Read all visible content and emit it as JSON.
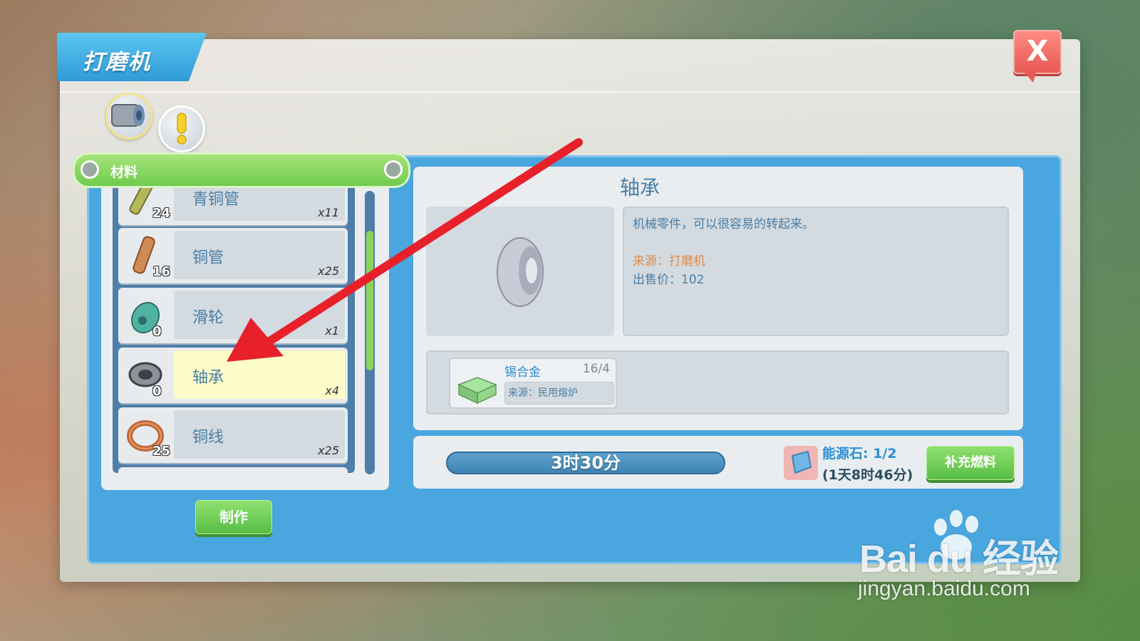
{
  "window": {
    "title": "打磨机",
    "close_label": "X"
  },
  "tabs": [
    {
      "name": "machine-tab",
      "icon": "bearing-machine-icon",
      "active": true
    },
    {
      "name": "info-tab",
      "icon": "exclamation-icon",
      "active": false
    }
  ],
  "category": {
    "label": "材料"
  },
  "items": [
    {
      "name": "青铜管",
      "count": "24",
      "qty": "x11",
      "icon": "bronze-pipe-icon",
      "selected": false
    },
    {
      "name": "铜管",
      "count": "16",
      "qty": "x25",
      "icon": "copper-pipe-icon",
      "selected": false
    },
    {
      "name": "滑轮",
      "count": "0",
      "qty": "x1",
      "icon": "pulley-icon",
      "selected": false
    },
    {
      "name": "轴承",
      "count": "0",
      "qty": "x4",
      "icon": "bearing-icon",
      "selected": true
    },
    {
      "name": "铜线",
      "count": "25",
      "qty": "x25",
      "icon": "copper-wire-icon",
      "selected": false
    }
  ],
  "make_button": "制作",
  "detail": {
    "title": "轴承",
    "description": "机械零件，可以很容易的转起来。",
    "source": "来源：打磨机",
    "price": "出售价：102"
  },
  "material": {
    "name": "锡合金",
    "count": "16/4",
    "source": "来源：民用熔炉",
    "icon": "tin-alloy-icon"
  },
  "timer": "3时30分",
  "energy": {
    "label": "能源石: 1/2",
    "time": "(1天8时46分)",
    "icon": "energy-stone-icon"
  },
  "refuel_button": "补充燃料",
  "watermark": {
    "logo": "Bai du 经验",
    "url": "jingyan.baidu.com"
  },
  "colors": {
    "accent_blue": "#4aa6de",
    "green": "#6fcb4e",
    "red": "#e75a55",
    "arrow": "#e8202a"
  }
}
